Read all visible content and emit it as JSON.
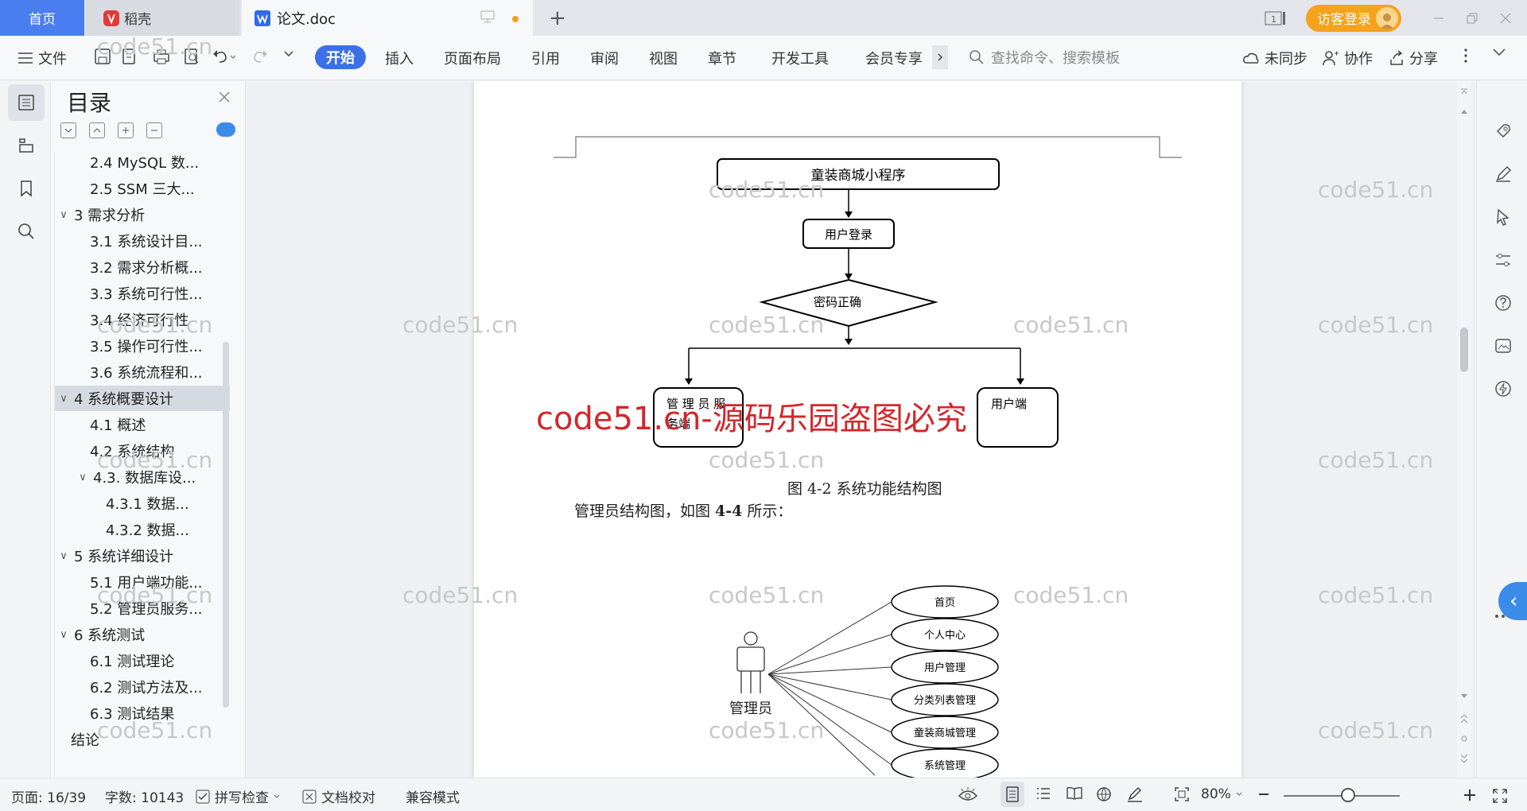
{
  "tabs": {
    "home": "首页",
    "daoke": "稻壳",
    "document": "论文.doc",
    "new_tab": "+"
  },
  "titlebar": {
    "login": "访客登录",
    "page_badge": "1"
  },
  "ribbon": {
    "file": "文件",
    "items": [
      "开始",
      "插入",
      "页面布局",
      "引用",
      "审阅",
      "视图",
      "章节",
      "开发工具",
      "会员专享"
    ],
    "search_placeholder": "查找命令、搜索模板",
    "unsynced": "未同步",
    "collab": "协作",
    "share": "分享"
  },
  "toc": {
    "title": "目录",
    "items": [
      {
        "label": "2.4 MySQL 数...",
        "level": 2,
        "chevron": ""
      },
      {
        "label": "2.5 SSM 三大...",
        "level": 2,
        "chevron": ""
      },
      {
        "label": "3  需求分析",
        "level": 1,
        "chevron": "∨"
      },
      {
        "label": "3.1  系统设计目...",
        "level": 2,
        "chevron": ""
      },
      {
        "label": "3.2 需求分析概...",
        "level": 2,
        "chevron": ""
      },
      {
        "label": "3.3  系统可行性...",
        "level": 2,
        "chevron": ""
      },
      {
        "label": "3.4 经济可行性",
        "level": 2,
        "chevron": ""
      },
      {
        "label": "3.5 操作可行性...",
        "level": 2,
        "chevron": ""
      },
      {
        "label": "3.6 系统流程和...",
        "level": 2,
        "chevron": ""
      },
      {
        "label": "4 系统概要设计",
        "level": 1,
        "chevron": "∨",
        "selected": true
      },
      {
        "label": "4.1  概述",
        "level": 2,
        "chevron": ""
      },
      {
        "label": "4.2  系统结构",
        "level": 2,
        "chevron": ""
      },
      {
        "label": "4.3.  数据库设...",
        "level": 2,
        "chevron": "∨"
      },
      {
        "label": "4.3.1  数据...",
        "level": 3,
        "chevron": ""
      },
      {
        "label": "4.3.2  数据...",
        "level": 3,
        "chevron": ""
      },
      {
        "label": "5 系统详细设计",
        "level": 1,
        "chevron": "∨"
      },
      {
        "label": "5.1 用户端功能...",
        "level": 2,
        "chevron": ""
      },
      {
        "label": "5.2 管理员服务...",
        "level": 2,
        "chevron": ""
      },
      {
        "label": "6  系统测试",
        "level": 1,
        "chevron": "∨"
      },
      {
        "label": "6.1  测试理论",
        "level": 2,
        "chevron": ""
      },
      {
        "label": "6.2  测试方法及...",
        "level": 2,
        "chevron": ""
      },
      {
        "label": "6.3  测试结果",
        "level": 2,
        "chevron": ""
      },
      {
        "label": "结论",
        "level": 1,
        "chevron": ""
      }
    ]
  },
  "document": {
    "flow": {
      "top": "童装商城小程序",
      "login": "用户登录",
      "check": "密码正确",
      "admin": "管 理 员 服\n务端",
      "admin_line1": "管 理 员 服",
      "admin_line2": "务端",
      "user": "用户端"
    },
    "caption": "图 4-2 系统功能结构图",
    "paragraph_prefix": "管理员结构图，如图 ",
    "paragraph_ref": "4-4",
    "paragraph_suffix": " 所示：",
    "usecase": {
      "actor": "管理员",
      "cases": [
        "首页",
        "个人中心",
        "用户管理",
        "分类列表管理",
        "童装商城管理",
        "系统管理"
      ]
    },
    "watermark": "code51.cn",
    "watermark_red": "code51.cn-源码乐园盗图必究"
  },
  "status": {
    "page": "页面: 16/39",
    "words": "字数: 10143",
    "spell": "拼写检查",
    "proof": "文档校对",
    "compat": "兼容模式",
    "zoom": "80%"
  },
  "colors": {
    "accent": "#3b70e8",
    "login": "#f5a21c",
    "watermark_red": "#d4262b"
  }
}
